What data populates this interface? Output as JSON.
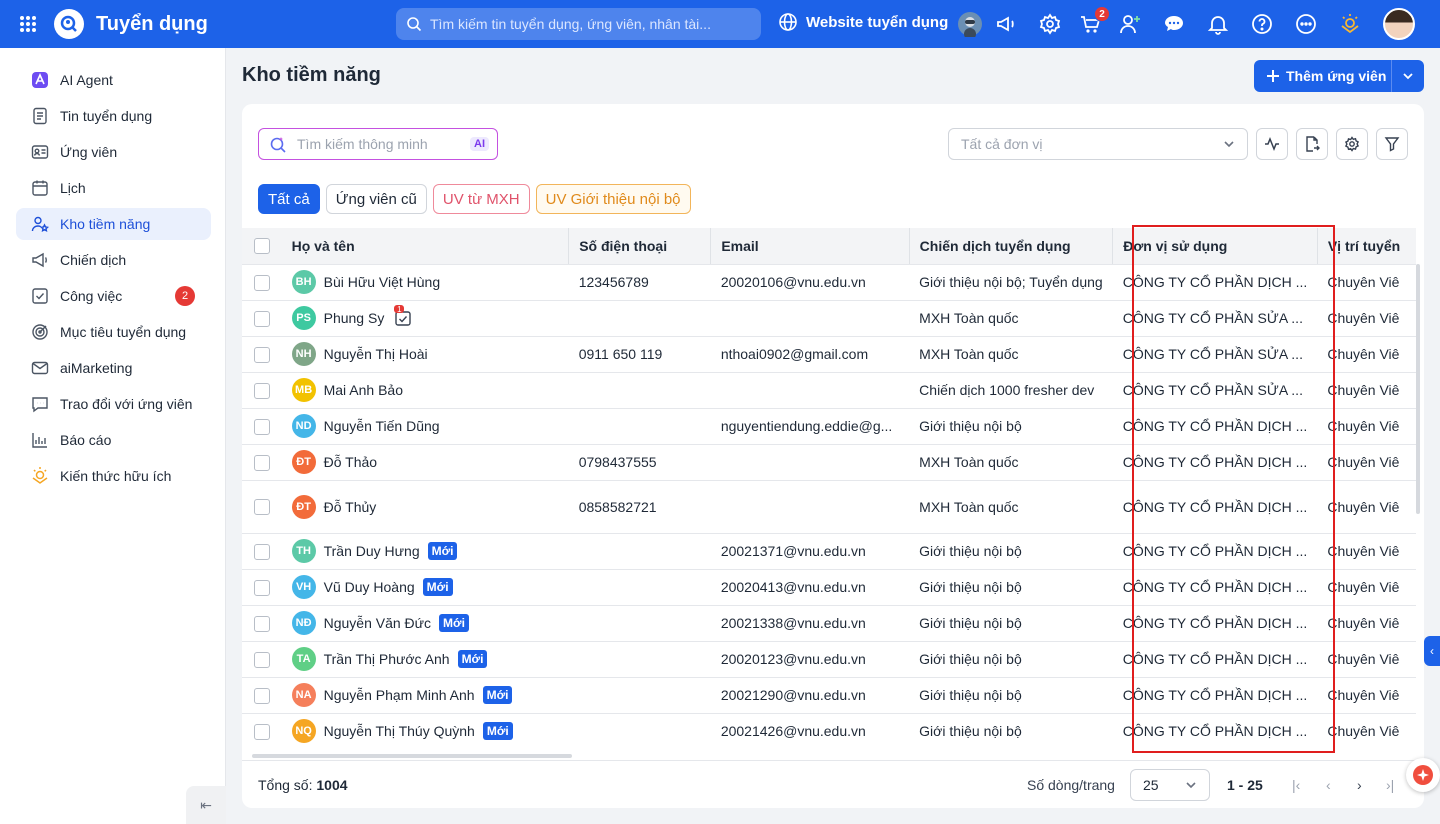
{
  "header": {
    "app_title": "Tuyển dụng",
    "search_placeholder": "Tìm kiếm tin tuyển dụng, ứng viên, nhân tài...",
    "website_link": "Website tuyển dụng",
    "cart_badge": "2",
    "colors": {
      "brand": "#1d62e8"
    }
  },
  "sidebar": {
    "items": [
      {
        "label": "AI Agent",
        "icon": "ai-agent-icon"
      },
      {
        "label": "Tin tuyển dụng",
        "icon": "document-icon"
      },
      {
        "label": "Ứng viên",
        "icon": "id-card-icon"
      },
      {
        "label": "Lịch",
        "icon": "calendar-icon"
      },
      {
        "label": "Kho tiềm năng",
        "icon": "user-star-icon"
      },
      {
        "label": "Chiến dịch",
        "icon": "megaphone-icon"
      },
      {
        "label": "Công việc",
        "icon": "task-icon",
        "badge": "2"
      },
      {
        "label": "Mục tiêu tuyển dụng",
        "icon": "target-icon"
      },
      {
        "label": "aiMarketing",
        "icon": "mail-icon"
      },
      {
        "label": "Trao đổi với ứng viên",
        "icon": "chat-icon"
      },
      {
        "label": "Báo cáo",
        "icon": "chart-icon"
      },
      {
        "label": "Kiến thức hữu ích",
        "icon": "lightbulb-icon"
      }
    ]
  },
  "page": {
    "title": "Kho tiềm năng",
    "add_button": "Thêm ứng viên"
  },
  "toolbar": {
    "smart_search_placeholder": "Tìm kiếm thông minh",
    "ai_tag": "AI",
    "unit_select_placeholder": "Tất cả đơn vị"
  },
  "filters": {
    "tabs": [
      "Tất cả",
      "Ứng viên cũ",
      "UV từ MXH",
      "UV Giới thiệu nội bộ"
    ]
  },
  "table": {
    "columns": [
      "Họ và tên",
      "Số điện thoại",
      "Email",
      "Chiến dịch tuyển dụng",
      "Đơn vị sử dụng",
      "Vị trí tuyển"
    ],
    "new_label": "Mới",
    "rows": [
      {
        "initials": "BH",
        "color": "#5cc9a7",
        "name": "Bùi Hữu Việt Hùng",
        "phone": "123456789",
        "email": "20020106@vnu.edu.vn",
        "campaign": "Giới thiệu nội bộ; Tuyển dụng",
        "unit": "CÔNG TY CỔ PHẦN DỊCH ...",
        "position": "Chuyên Viê"
      },
      {
        "initials": "PS",
        "color": "#3ec9a0",
        "name": "Phung Sy",
        "phone": "",
        "email": "",
        "campaign": "MXH Toàn quốc",
        "unit": "CÔNG TY CỔ PHẦN SỬA ...",
        "position": "Chuyên Viê",
        "calendar": true,
        "calendar_badge": "1"
      },
      {
        "initials": "NH",
        "color": "#7fa688",
        "name": "Nguyễn Thị Hoài",
        "phone": "0911 650 119",
        "email": "nthoai0902@gmail.com",
        "campaign": "MXH Toàn quốc",
        "unit": "CÔNG TY CỔ PHẦN SỬA ...",
        "position": "Chuyên Viê"
      },
      {
        "initials": "MB",
        "color": "#f2c200",
        "name": "Mai Anh Bảo",
        "phone": "",
        "email": "",
        "campaign": "Chiến dịch 1000 fresher dev",
        "unit": "CÔNG TY CỔ PHẦN SỬA ...",
        "position": "Chuyên Viê"
      },
      {
        "initials": "ND",
        "color": "#44b6e8",
        "name": "Nguyễn Tiến Dũng",
        "phone": "",
        "email": "nguyentiendung.eddie@g...",
        "campaign": "Giới thiệu nội bộ",
        "unit": "CÔNG TY CỔ PHẦN DỊCH ...",
        "position": "Chuyên Viê"
      },
      {
        "initials": "ĐT",
        "color": "#f26b3a",
        "name": "Đỗ Thảo",
        "phone": "0798437555",
        "email": "",
        "campaign": "MXH Toàn quốc",
        "unit": "CÔNG TY CỔ PHẦN DỊCH ...",
        "position": "Chuyên Viê"
      },
      {
        "initials": "ĐT",
        "color": "#f26b3a",
        "name": "Đỗ Thủy",
        "phone": "0858582721",
        "email": "",
        "campaign": "MXH Toàn quốc",
        "unit": "CÔNG TY CỔ PHẦN DỊCH ...",
        "position": "Chuyên Viê",
        "tall": true
      },
      {
        "initials": "TH",
        "color": "#5cc9a7",
        "name": "Trần Duy Hưng",
        "phone": "",
        "email": "20021371@vnu.edu.vn",
        "campaign": "Giới thiệu nội bộ",
        "unit": "CÔNG TY CỔ PHẦN DỊCH ...",
        "position": "Chuyên Viê",
        "new": true
      },
      {
        "initials": "VH",
        "color": "#44b6e8",
        "name": "Vũ Duy Hoàng",
        "phone": "",
        "email": "20020413@vnu.edu.vn",
        "campaign": "Giới thiệu nội bộ",
        "unit": "CÔNG TY CỔ PHẦN DỊCH ...",
        "position": "Chuyên Viê",
        "new": true
      },
      {
        "initials": "NĐ",
        "color": "#44b6e8",
        "name": "Nguyễn Văn Đức",
        "phone": "",
        "email": "20021338@vnu.edu.vn",
        "campaign": "Giới thiệu nội bộ",
        "unit": "CÔNG TY CỔ PHẦN DỊCH ...",
        "position": "Chuyên Viê",
        "new": true
      },
      {
        "initials": "TA",
        "color": "#5fcf86",
        "name": "Trần Thị Phước Anh",
        "phone": "",
        "email": "20020123@vnu.edu.vn",
        "campaign": "Giới thiệu nội bộ",
        "unit": "CÔNG TY CỔ PHẦN DỊCH ...",
        "position": "Chuyên Viê",
        "new": true
      },
      {
        "initials": "NA",
        "color": "#f57f5b",
        "name": "Nguyễn Phạm Minh Anh",
        "phone": "",
        "email": "20021290@vnu.edu.vn",
        "campaign": "Giới thiệu nội bộ",
        "unit": "CÔNG TY CỔ PHẦN DỊCH ...",
        "position": "Chuyên Viê",
        "new": true
      },
      {
        "initials": "NQ",
        "color": "#f5a623",
        "name": "Nguyễn Thị Thúy Quỳnh",
        "phone": "",
        "email": "20021426@vnu.edu.vn",
        "campaign": "Giới thiệu nội bộ",
        "unit": "CÔNG TY CỔ PHẦN DỊCH ...",
        "position": "Chuyên Viê",
        "new": true
      }
    ]
  },
  "footer": {
    "total_label": "Tổng số:",
    "total_value": "1004",
    "rows_per_page_label": "Số dòng/trang",
    "rows_per_page_value": "25",
    "range": "1 - 25"
  }
}
